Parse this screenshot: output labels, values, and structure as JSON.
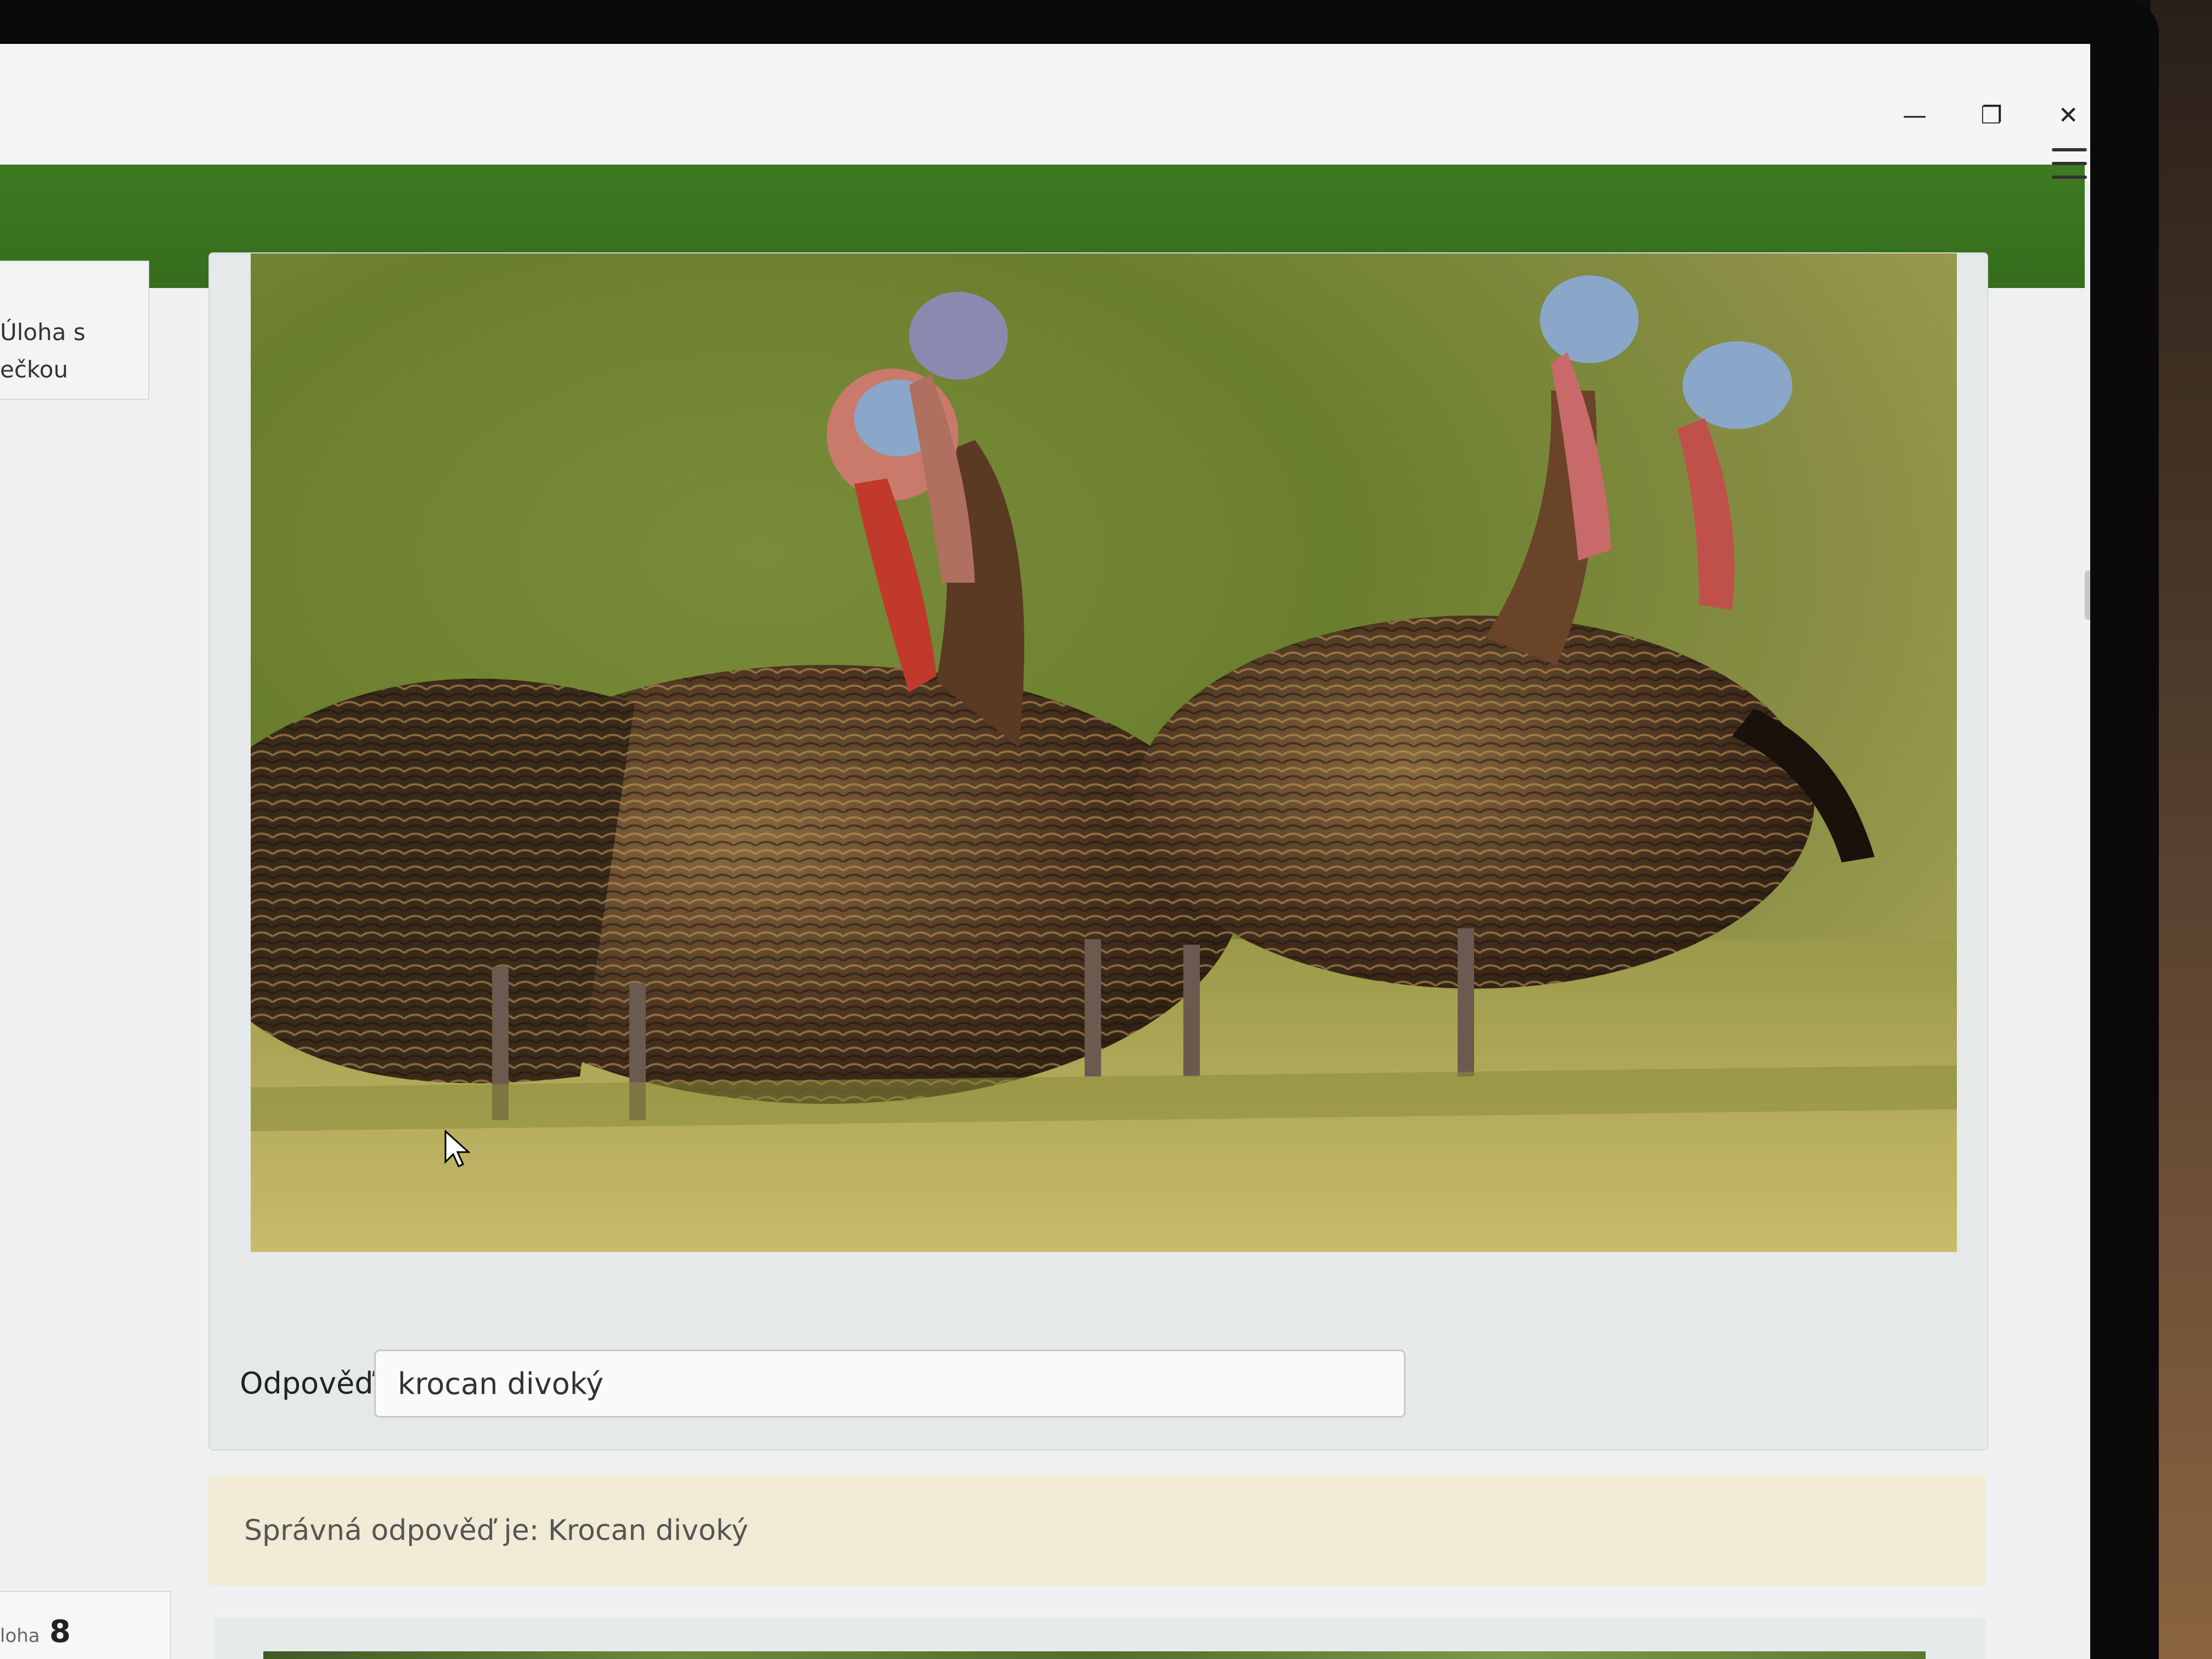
{
  "window": {
    "minimize_glyph": "—",
    "maximize_glyph": "❐",
    "close_glyph": "✕"
  },
  "sidebar": {
    "task_item_text_line1": "Úloha s",
    "task_item_text_line2": "ečkou",
    "next_task_label": "loha",
    "next_task_number": "8"
  },
  "question": {
    "image_subject_icon": "turkey-photo",
    "answer_label": "Odpověď:",
    "answer_value": "krocan divoký"
  },
  "feedback": {
    "text": "Správná odpověď je: Krocan divoký"
  },
  "colors": {
    "header_green": "#3a7420",
    "feedback_bg": "#f1ead4",
    "page_bg": "#eef0f1"
  },
  "icons": {
    "menu": "hamburger-icon",
    "cursor": "mouse-pointer-icon"
  }
}
